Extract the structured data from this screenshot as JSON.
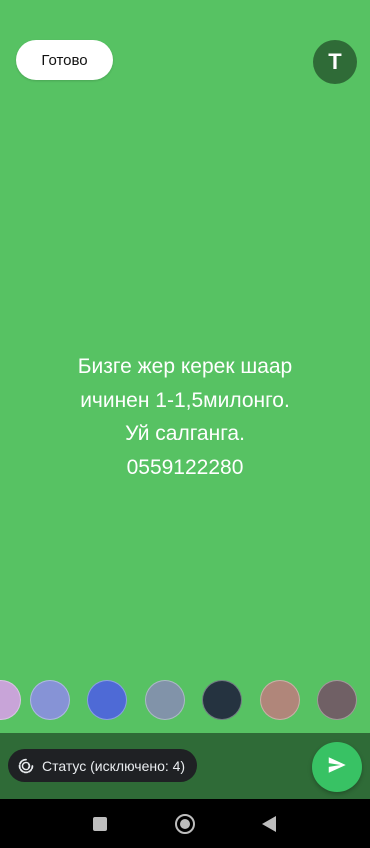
{
  "header": {
    "done_label": "Готово",
    "text_mode_label": "T"
  },
  "status": {
    "lines": [
      "Бизге жер керек шаар",
      "ичинен 1-1,5милонго.",
      "Уй салганга.",
      "0559122280"
    ],
    "background_color": "#57c263",
    "text_color": "#ffffff"
  },
  "color_palette": {
    "swatches": [
      {
        "name": "pink",
        "color": "#c8a4d8"
      },
      {
        "name": "lavender",
        "color": "#8693d6"
      },
      {
        "name": "blue",
        "color": "#4e6ad6"
      },
      {
        "name": "slate-gray",
        "color": "#8193a9"
      },
      {
        "name": "dark-navy",
        "color": "#253340"
      },
      {
        "name": "dusty-rose",
        "color": "#b0867a"
      },
      {
        "name": "taupe",
        "color": "#706065"
      }
    ]
  },
  "bottom_bar": {
    "privacy_label": "Статус (исключено: 4)",
    "privacy_icon": "status-privacy-icon",
    "send_icon": "send-icon",
    "send_color": "#38c264"
  },
  "nav": {
    "icons": [
      "square-recents-icon",
      "circle-home-icon",
      "triangle-back-icon"
    ]
  }
}
